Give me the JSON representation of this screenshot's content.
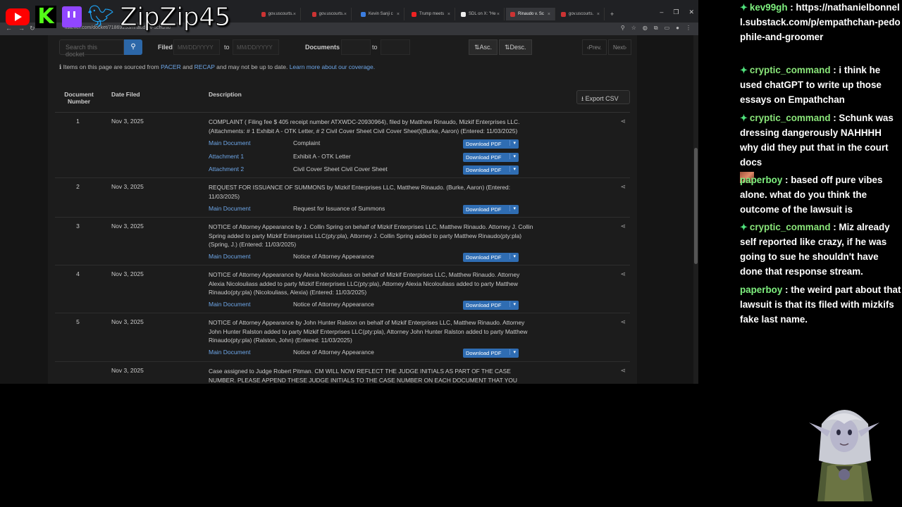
{
  "streamer": {
    "name": "ZipZip45"
  },
  "browser": {
    "tabs": [
      {
        "label": "gov.uscourts."
      },
      {
        "label": "gov.uscourts."
      },
      {
        "label": "Kevin Sanji c"
      },
      {
        "label": "Trump meets"
      },
      {
        "label": "SDL on X: \"He"
      },
      {
        "label": "Rinaudo v. Sc"
      },
      {
        "label": "gov.uscourts."
      }
    ],
    "new_tab": "+",
    "url": "listener.com/docket/71869253/rinaudo-v-schunk/"
  },
  "filters": {
    "search_placeholder": "Search this docket",
    "filed_label": "Filed",
    "date_placeholder": "MM/DD/YYYY",
    "to_label": "to",
    "documents_label": "Documents",
    "asc_label": "Asc.",
    "desc_label": "Desc.",
    "prev_label": "Prev.",
    "next_label": "Next"
  },
  "notice": {
    "text1": "Items on this page are sourced from",
    "pacer": "PACER",
    "and": "and",
    "recap": "RECAP",
    "text2": "and may not be up to date.",
    "learn_more": "Learn more about our coverage."
  },
  "table": {
    "headers": {
      "doc_num_1": "Document",
      "doc_num_2": "Number",
      "date": "Date Filed",
      "description": "Description"
    },
    "export_label": "Export CSV",
    "download_label": "Download PDF",
    "rows": [
      {
        "num": "1",
        "date": "Nov 3, 2025",
        "desc": "COMPLAINT ( Filing fee $ 405 receipt number ATXWDC-20930964), filed by Matthew Rinaudo, Mizkif Enterprises LLC. (Attachments: # 1 Exhibit A - OTK Letter, # 2 Civil Cover Sheet Civil Cover Sheet)(Burke, Aaron) (Entered: 11/03/2025)",
        "subs": [
          {
            "link": "Main Document",
            "desc": "Complaint"
          },
          {
            "link": "Attachment 1",
            "desc": "Exhibit A - OTK Letter"
          },
          {
            "link": "Attachment 2",
            "desc": "Civil Cover Sheet Civil Cover Sheet"
          }
        ]
      },
      {
        "num": "2",
        "date": "Nov 3, 2025",
        "desc": "REQUEST FOR ISSUANCE OF SUMMONS by Mizkif Enterprises LLC, Matthew Rinaudo. (Burke, Aaron) (Entered: 11/03/2025)",
        "subs": [
          {
            "link": "Main Document",
            "desc": "Request for Issuance of Summons"
          }
        ]
      },
      {
        "num": "3",
        "date": "Nov 3, 2025",
        "desc": "NOTICE of Attorney Appearance by J. Collin Spring on behalf of Mizkif Enterprises LLC, Matthew Rinaudo. Attorney J. Collin Spring added to party Mizkif Enterprises LLC(pty:pla), Attorney J. Collin Spring added to party Matthew Rinaudo(pty:pla) (Spring, J.) (Entered: 11/03/2025)",
        "subs": [
          {
            "link": "Main Document",
            "desc": "Notice of Attorney Appearance"
          }
        ]
      },
      {
        "num": "4",
        "date": "Nov 3, 2025",
        "desc": "NOTICE of Attorney Appearance by Alexia Nicolouliass on behalf of Mizkif Enterprises LLC, Matthew Rinaudo. Attorney Alexia Nicolouliass added to party Mizkif Enterprises LLC(pty:pla), Attorney Alexia Nicolouliass added to party Matthew Rinaudo(pty:pla) (Nicolouliass, Alexia) (Entered: 11/03/2025)",
        "subs": [
          {
            "link": "Main Document",
            "desc": "Notice of Attorney Appearance"
          }
        ]
      },
      {
        "num": "5",
        "date": "Nov 3, 2025",
        "desc": "NOTICE of Attorney Appearance by John Hunter Ralston on behalf of Mizkif Enterprises LLC, Matthew Rinaudo. Attorney John Hunter Ralston added to party Mizkif Enterprises LLC(pty:pla), Attorney John Hunter Ralston added to party Matthew Rinaudo(pty:pla) (Ralston, John) (Entered: 11/03/2025)",
        "subs": [
          {
            "link": "Main Document",
            "desc": "Notice of Attorney Appearance"
          }
        ]
      },
      {
        "num": "",
        "date": "Nov 3, 2025",
        "desc": "Case assigned to Judge Robert Pitman. CM WILL NOW REFLECT THE JUDGE INITIALS AS PART OF THE CASE NUMBER. PLEASE APPEND THESE JUDGE INITIALS TO THE CASE NUMBER ON EACH DOCUMENT THAT YOU",
        "subs": []
      }
    ]
  },
  "chat": [
    {
      "user": "kev99gh",
      "badge": true,
      "text": "https://nathanielbonnell.substack.com/p/empathchan-pedophile-and-groomer"
    },
    {
      "user": "cryptic_command",
      "badge": true,
      "text": "i think he used chatGPT to write up those essays on Empathchan"
    },
    {
      "user": "cryptic_command",
      "badge": true,
      "text": "Schunk was dressing dangerously NAHHHH why did they put that in the court docs"
    },
    {
      "user": "paperboy",
      "badge": false,
      "text": "based off pure vibes alone. what do you think the outcome of the lawsuit is"
    },
    {
      "user": "cryptic_command",
      "badge": true,
      "text": "Miz already self reported like crazy, if he was going to sue he shouldn't have done that response stream."
    },
    {
      "user": "paperboy",
      "badge": false,
      "text": "the weird part about that lawsuit is that its filed with mizkifs fake last name."
    }
  ]
}
